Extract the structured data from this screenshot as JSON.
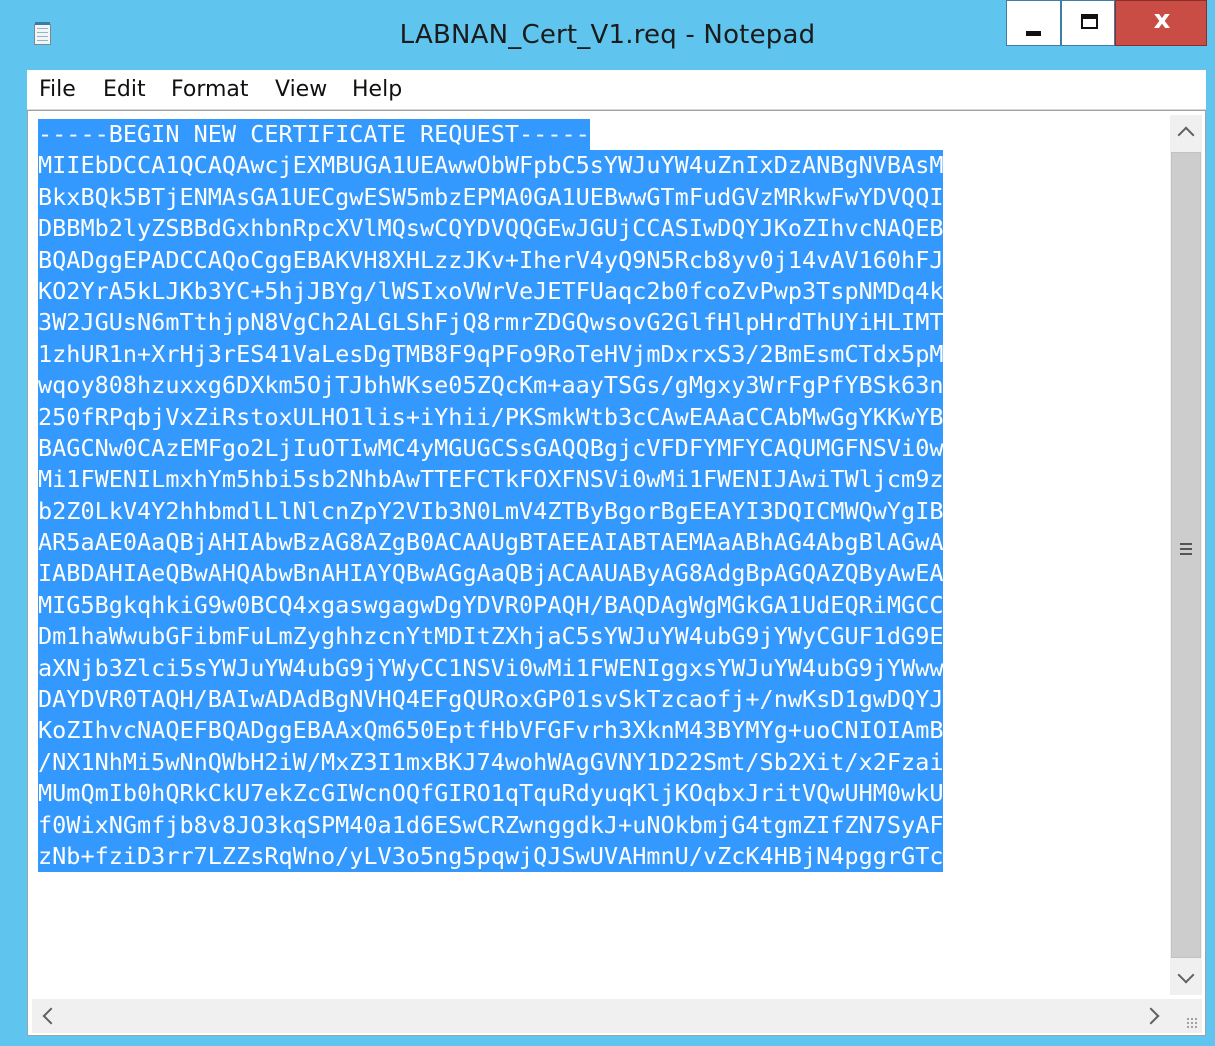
{
  "window": {
    "title": "LABNAN_Cert_V1.req - Notepad",
    "icon": "notepad-icon",
    "controls": {
      "minimize": "minimize-icon",
      "maximize": "maximize-icon",
      "close_glyph": "x"
    }
  },
  "menu": {
    "file": "File",
    "edit": "Edit",
    "format": "Format",
    "view": "View",
    "help": "Help"
  },
  "editor": {
    "selection_color": "#3399ff",
    "selected": true,
    "lines": [
      "-----BEGIN NEW CERTIFICATE REQUEST-----",
      "MIIEbDCCA1QCAQAwcjEXMBUGA1UEAwwObWFpbC5sYWJuYW4uZnIxDzANBgNVBAsM",
      "BkxBQk5BTjENMAsGA1UECgwESW5mbzEPMA0GA1UEBwwGTmFudGVzMRkwFwYDVQQI",
      "DBBMb2lyZSBBdGxhbnRpcXVlMQswCQYDVQQGEwJGUjCCASIwDQYJKoZIhvcNAQEB",
      "BQADggEPADCCAQoCggEBAKVH8XHLzzJKv+IherV4yQ9N5Rcb8yv0j14vAV160hFJ",
      "KO2YrA5kLJKb3YC+5hjJBYg/lWSIxoVWrVeJETFUaqc2b0fcoZvPwp3TspNMDq4k",
      "3W2JGUsN6mTthjpN8VgCh2ALGLShFjQ8rmrZDGQwsovG2GlfHlpHrdThUYiHLIMT",
      "1zhUR1n+XrHj3rES41VaLesDgTMB8F9qPFo9RoTeHVjmDxrxS3/2BmEsmCTdx5pM",
      "wqoy808hzuxxg6DXkm5OjTJbhWKse05ZQcKm+aayTSGs/gMgxy3WrFgPfYBSk63n",
      "250fRPqbjVxZiRstoxULHO1lis+iYhii/PKSmkWtb3cCAwEAAaCCAbMwGgYKKwYB",
      "BAGCNw0CAzEMFgo2LjIuOTIwMC4yMGUGCSsGAQQBgjcVFDFYMFYCAQUMGFNSVi0w",
      "Mi1FWENILmxhYm5hbi5sb2NhbAwTTEFCTkFOXFNSVi0wMi1FWENIJAwiTWljcm9z",
      "b2Z0LkV4Y2hhbmdlLlNlcnZpY2VIb3N0LmV4ZTByBgorBgEEAYI3DQICMWQwYgIB",
      "AR5aAE0AaQBjAHIAbwBzAG8AZgB0ACAAUgBTAEEAIABTAEMAaABhAG4AbgBlAGwA",
      "IABDAHIAeQBwAHQAbwBnAHIAYQBwAGgAaQBjACAAUAByAG8AdgBpAGQAZQByAwEA",
      "MIG5BgkqhkiG9w0BCQ4xgaswgagwDgYDVR0PAQH/BAQDAgWgMGkGA1UdEQRiMGCC",
      "Dm1haWwubGFibmFuLmZyghhzcnYtMDItZXhjaC5sYWJuYW4ubG9jYWyCGUF1dG9E",
      "aXNjb3Zlci5sYWJuYW4ubG9jYWyCC1NSVi0wMi1FWENIggxsYWJuYW4ubG9jYWww",
      "DAYDVR0TAQH/BAIwADAdBgNVHQ4EFgQURoxGP01svSkTzcaofj+/nwKsD1gwDQYJ",
      "KoZIhvcNAQEFBQADggEBAAxQm650EptfHbVFGFvrh3XknM43BYMYg+uoCNIOIAmB",
      "/NX1NhMi5wNnQWbH2iW/MxZ3I1mxBKJ74wohWAgGVNY1D22Smt/Sb2Xit/x2Fzai",
      "MUmQmIb0hQRkCkU7ekZcGIWcnOQfGIRO1qTquRdyuqKljKOqbxJritVQwUHM0wkU",
      "f0WixNGmfjb8v8JO3kqSPM40a1d6ESwCRZwnggdkJ+uNOkbmjG4tgmZIfZN7SyAF",
      "zNb+fziD3rr7LZZsRqWno/yLV3o5ng5pqwjQJSwUVAHmnU/vZcK4HBjN4pggrGTc"
    ]
  },
  "scrollbars": {
    "up": "chevron-up-icon",
    "down": "chevron-down-icon",
    "left": "chevron-left-icon",
    "right": "chevron-right-icon",
    "grip": "resize-grip-icon"
  }
}
